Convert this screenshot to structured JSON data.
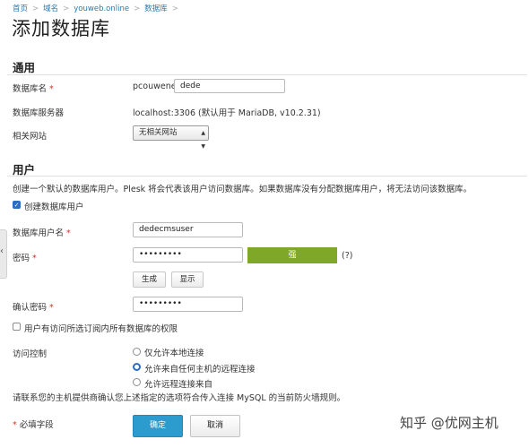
{
  "breadcrumb": [
    "首页",
    "域名",
    "youweb.online",
    "数据库"
  ],
  "page_title": "添加数据库",
  "general": {
    "title": "通用",
    "db_name_label": "数据库名",
    "required_mark": "*",
    "db_prefix": "pcouwene_",
    "db_name_value": "dede",
    "server_label": "数据库服务器",
    "server_value": "localhost:3306 (默认用于 MariaDB, v10.2.31)",
    "site_label": "相关网站",
    "site_value": "无相关网站"
  },
  "user": {
    "title": "用户",
    "description": "创建一个默认的数据库用户。Plesk 将会代表该用户访问数据库。如果数据库没有分配数据库用户，将无法访问该数据库。",
    "create_user_label": "创建数据库用户",
    "create_user_checked": true,
    "username_label": "数据库用户名",
    "username_value": "dedecmsuser",
    "password_label": "密码",
    "password_value": "•••••••••",
    "strength_label": "强",
    "strength_fraction": 1.0,
    "help_mark": "(?)",
    "generate_label": "生成",
    "show_label": "显示",
    "confirm_label": "确认密码",
    "confirm_value": "•••••••••",
    "all_db_access_label": "用户有访问所选订阅内所有数据库的权限",
    "all_db_access_checked": false,
    "access_control_label": "访问控制",
    "access_options": [
      "仅允许本地连接",
      "允许来自任何主机的远程连接",
      "允许远程连接来自"
    ],
    "access_selected_index": 1,
    "firewall_note": "请联系您的主机提供商确认您上述指定的选项符合传入连接 MySQL 的当前防火墙规则。"
  },
  "footer": {
    "required_note_label": "必填字段",
    "ok_label": "确定",
    "cancel_label": "取消"
  },
  "watermark": "知乎 @优网主机",
  "colors": {
    "accent": "#2c9ccf",
    "strength_strong": "#7fa829",
    "required": "#d0342c",
    "link": "#2a7ab0"
  },
  "icons": {
    "side_tab": "chevron-left-icon",
    "select_arrow": "dropdown-arrow-icon",
    "checkmark": "checkmark-icon"
  }
}
